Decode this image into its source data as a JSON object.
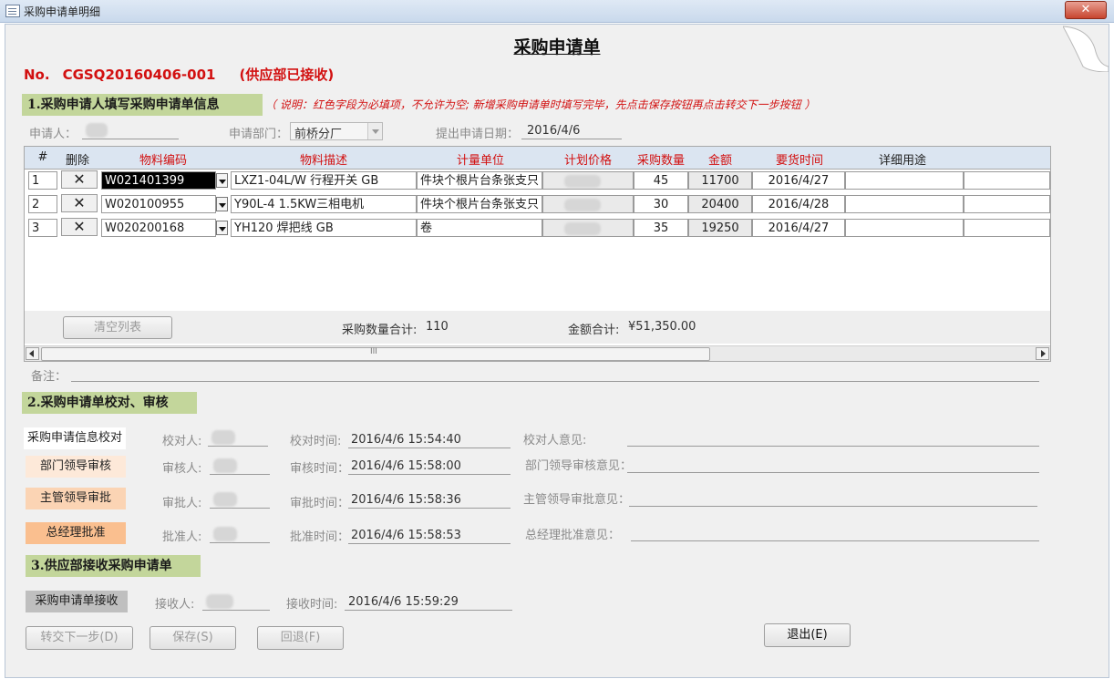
{
  "window": {
    "title": "采购申请单明细",
    "close_label": "✕"
  },
  "form": {
    "title": "采购申请单",
    "number_prefix": "No.",
    "number": "CGSQ20160406-001",
    "status": "(供应部已接收)"
  },
  "section1": {
    "label": "1.采购申请人填写采购申请单信息",
    "note": "（ 说明：红色字段为必填项，不允许为空; 新增采购申请单时填写完毕，先点击保存按钮再点击转交下一步按钮 ）",
    "applicant_label": "申请人：",
    "dept_label": "申请部门：",
    "dept_value": "前桥分厂",
    "date_label": "提出申请日期：",
    "date_value": "2016/4/6"
  },
  "grid": {
    "headers": [
      "#",
      "删除",
      "物料编码",
      "物料描述",
      "计量单位",
      "计划价格",
      "采购数量",
      "金额",
      "要货时间",
      "详细用途"
    ],
    "rows": [
      {
        "no": "1",
        "del": "✕",
        "code": "W021401399",
        "desc": "LXZ1-04L/W 行程开关 GB",
        "unit": "件块个根片台条张支只",
        "qty": "45",
        "amount": "11700",
        "date": "2016/4/27",
        "use": ""
      },
      {
        "no": "2",
        "del": "✕",
        "code": "W020100955",
        "desc": "Y90L-4   1.5KW三相电机",
        "unit": "件块个根片台条张支只",
        "qty": "30",
        "amount": "20400",
        "date": "2016/4/28",
        "use": ""
      },
      {
        "no": "3",
        "del": "✕",
        "code": "W020200168",
        "desc": "YH120 焊把线 GB",
        "unit": "卷",
        "qty": "35",
        "amount": "19250",
        "date": "2016/4/27",
        "use": ""
      }
    ],
    "clear_button": "清空列表",
    "qty_total_label": "采购数量合计:",
    "qty_total": "110",
    "amount_total_label": "金额合计:",
    "amount_total": "¥51,350.00",
    "scroll_grip": "III"
  },
  "remark_label": "备注：",
  "section2": {
    "label": "2.采购申请单校对、审核",
    "rows": [
      {
        "step": "采购申请信息校对",
        "person_label": "校对人:",
        "time_label": "校对时间:",
        "time": "2016/4/6 15:54:40",
        "opinion_label": "校对人意见:",
        "color": "#ffffff",
        "text_color": "#222222"
      },
      {
        "step": "部门领导审核",
        "person_label": "审核人:",
        "time_label": "审核时间：",
        "time": "2016/4/6 15:58:00",
        "opinion_label": "部门领导审核意见：",
        "color": "#fde9d9",
        "text_color": "#222222"
      },
      {
        "step": "主管领导审批",
        "person_label": "审批人:",
        "time_label": "审批时间：",
        "time": "2016/4/6 15:58:36",
        "opinion_label": "主管领导审批意见：",
        "color": "#fbd4b4",
        "text_color": "#222222"
      },
      {
        "step": "总经理批准",
        "person_label": "批准人:",
        "time_label": "批准时间：",
        "time": "2016/4/6 15:58:53",
        "opinion_label": "总经理批准意见：",
        "color": "#fabf8f",
        "text_color": "#222222"
      }
    ]
  },
  "section3": {
    "label": "3.供应部接收采购申请单",
    "step": "采购申请单接收",
    "receiver_label": "接收人:",
    "time_label": "接收时间:",
    "time": "2016/4/6 15:59:29"
  },
  "buttons": {
    "forward": "转交下一步(D)",
    "save": "保存(S)",
    "back": "回退(F)",
    "exit": "退出(E)"
  },
  "colors": {
    "accent_red": "#d21010",
    "section_green": "#c3d69b",
    "grid_header": "#dbe5f1"
  }
}
